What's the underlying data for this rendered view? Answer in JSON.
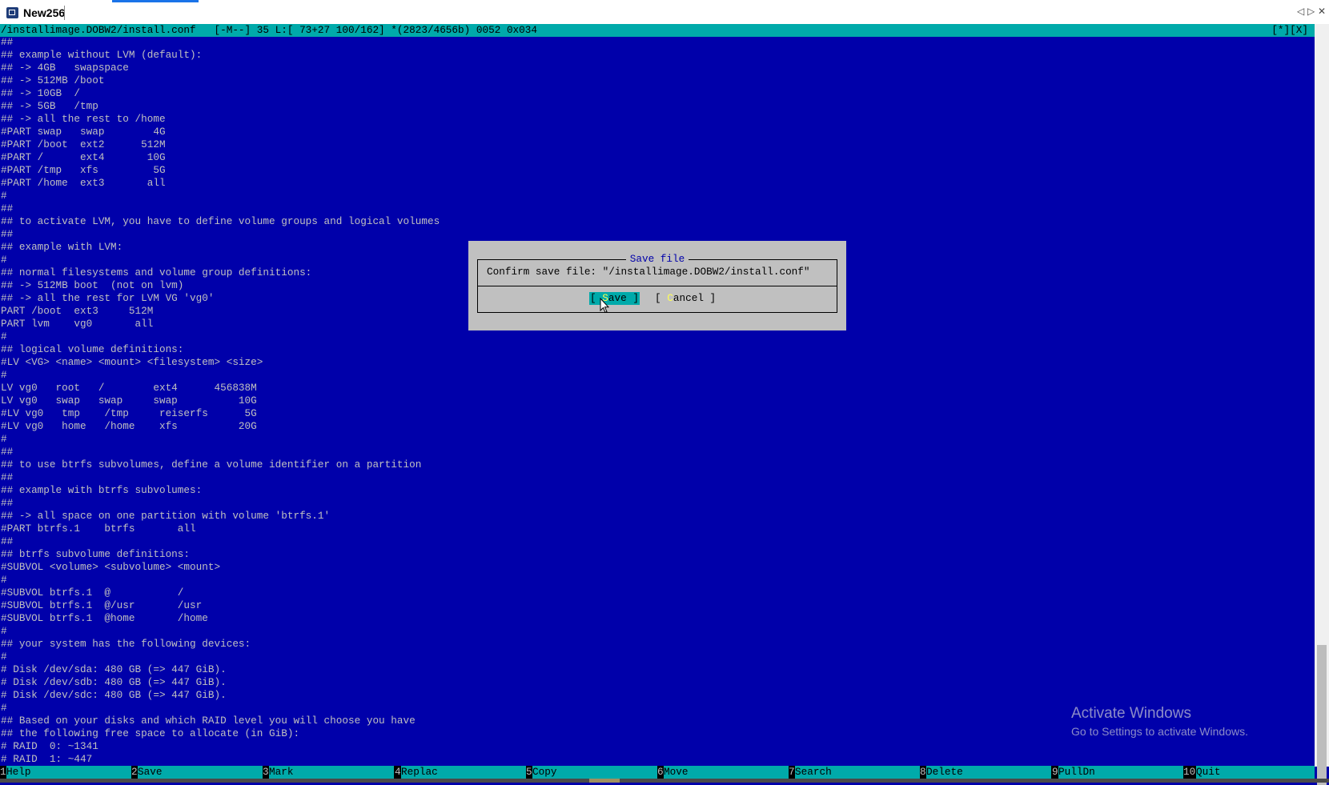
{
  "window": {
    "title": "New256",
    "controls": [
      "◁",
      "▷",
      "✕"
    ]
  },
  "status_bar": {
    "text": "/installimage.DOBW2/install.conf   [-M--] 35 L:[ 73+27 100/162] *(2823/4656b) 0052 0x034",
    "right": "[*][X]"
  },
  "editor_lines": [
    "##",
    "## example without LVM (default):",
    "## -> 4GB   swapspace",
    "## -> 512MB /boot",
    "## -> 10GB  /",
    "## -> 5GB   /tmp",
    "## -> all the rest to /home",
    "#PART swap   swap        4G",
    "#PART /boot  ext2      512M",
    "#PART /      ext4       10G",
    "#PART /tmp   xfs         5G",
    "#PART /home  ext3       all",
    "#",
    "##",
    "## to activate LVM, you have to define volume groups and logical volumes",
    "##",
    "## example with LVM:",
    "#",
    "## normal filesystems and volume group definitions:",
    "## -> 512MB boot  (not on lvm)",
    "## -> all the rest for LVM VG 'vg0'",
    "PART /boot  ext3     512M",
    "PART lvm    vg0       all",
    "#",
    "## logical volume definitions:",
    "#LV <VG> <name> <mount> <filesystem> <size>",
    "#",
    "LV vg0   root   /        ext4      456838M",
    "LV vg0   swap   swap     swap          10G",
    "#LV vg0   tmp    /tmp     reiserfs      5G",
    "#LV vg0   home   /home    xfs          20G",
    "#",
    "##",
    "## to use btrfs subvolumes, define a volume identifier on a partition",
    "##",
    "## example with btrfs subvolumes:",
    "##",
    "## -> all space on one partition with volume 'btrfs.1'",
    "#PART btrfs.1    btrfs       all",
    "##",
    "## btrfs subvolume definitions:",
    "#SUBVOL <volume> <subvolume> <mount>",
    "#",
    "#SUBVOL btrfs.1  @           /",
    "#SUBVOL btrfs.1  @/usr       /usr",
    "#SUBVOL btrfs.1  @home       /home",
    "#",
    "## your system has the following devices:",
    "#",
    "# Disk /dev/sda: 480 GB (=> 447 GiB).",
    "# Disk /dev/sdb: 480 GB (=> 447 GiB).",
    "# Disk /dev/sdc: 480 GB (=> 447 GiB).",
    "#",
    "## Based on your disks and which RAID level you will choose you have",
    "## the following free space to allocate (in GiB):",
    "# RAID  0: ~1341",
    "# RAID  1: ~447"
  ],
  "dialog": {
    "title": "Save file",
    "message": "Confirm save file: \"/installimage.DOBW2/install.conf\"",
    "save": {
      "pre": "[ ",
      "hot": "S",
      "post": "ave ]"
    },
    "cancel": {
      "pre": "[ ",
      "hot": "C",
      "post": "ancel ]"
    }
  },
  "fkeys": [
    {
      "num": "1",
      "label": "Help"
    },
    {
      "num": "2",
      "label": "Save"
    },
    {
      "num": "3",
      "label": "Mark"
    },
    {
      "num": "4",
      "label": "Replac"
    },
    {
      "num": "5",
      "label": "Copy"
    },
    {
      "num": "6",
      "label": "Move"
    },
    {
      "num": "7",
      "label": "Search"
    },
    {
      "num": "8",
      "label": "Delete"
    },
    {
      "num": "9",
      "label": "PullDn"
    },
    {
      "num": "10",
      "label": "Quit"
    }
  ],
  "watermark": {
    "title": "Activate Windows",
    "subtitle": "Go to Settings to activate Windows."
  },
  "colors": {
    "editor_bg": "#0000aa",
    "editor_fg": "#c0c0c0",
    "accent": "#00aaaa",
    "dialog_bg": "#c0c0c0",
    "hotkey": "#ffff55"
  }
}
